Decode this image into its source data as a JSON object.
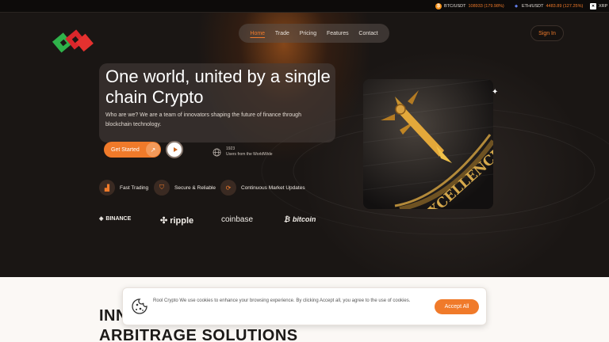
{
  "ticker": [
    {
      "symbol": "BTC/USDT",
      "value": "108933 (179.98%)",
      "icon": "btc-icon",
      "icon_color": "#f7931a",
      "glyph": "₿"
    },
    {
      "symbol": "ETH/USDT",
      "value": "4483.89 (127.25%)",
      "icon": "eth-icon",
      "icon_color": "#627eea",
      "glyph": "◆"
    },
    {
      "symbol": "XRP",
      "value": "",
      "icon": "xrp-icon",
      "icon_color": "#ffffff",
      "glyph": "✕"
    }
  ],
  "nav": {
    "items": [
      "Home",
      "Trade",
      "Pricing",
      "Features",
      "Contact"
    ],
    "active_index": 0,
    "signin": "Sign In"
  },
  "hero": {
    "title": "One world, united by a single chain Crypto",
    "description": "Who are we? We are a team of innovators shaping the future of finance through blockchain technology.",
    "cta": "Get Started",
    "users_count": "1923",
    "users_label": "Users from the WorldWide"
  },
  "features": [
    {
      "label": "Fast Trading",
      "icon": "chart-icon"
    },
    {
      "label": "Secure & Reliable",
      "icon": "shield-icon"
    },
    {
      "label": "Continuous Market Updates",
      "icon": "refresh-icon"
    }
  ],
  "partners": [
    "BINANCE",
    "ripple",
    "coinbase",
    "bitcoin"
  ],
  "image": {
    "text": "EXCELLENCE"
  },
  "lower": {
    "heading1": "INN",
    "heading2": "ARBITRAGE SOLUTIONS"
  },
  "cookie": {
    "message": "Rool Crypto We use cookies to enhance your browsing experience. By clicking Accept all, you agree to the use of cookies.",
    "accept": "Accept All"
  },
  "colors": {
    "accent": "#f07a2a",
    "background": "#171412"
  }
}
